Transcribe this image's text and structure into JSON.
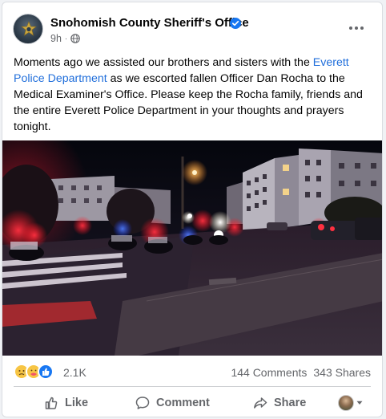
{
  "post": {
    "page_name": "Snohomish County Sheriff's Office",
    "time": "9h",
    "separator": "·",
    "text_before": "Moments ago we assisted our brothers and sisters with the ",
    "link_text": "Everett Police Department",
    "text_after": " as we escorted fallen Officer Dan Rocha to the Medical Examiner's Office. Please keep the Rocha family, friends and the entire Everett Police Department in your thoughts and prayers tonight."
  },
  "photo": {
    "description_icon": "night-police-escort-photo"
  },
  "reactions": {
    "icons": [
      "sad-reaction-icon",
      "care-reaction-icon",
      "like-reaction-icon"
    ],
    "count": "2.1K",
    "comments": "144 Comments",
    "shares": "343 Shares"
  },
  "actions": {
    "like": "Like",
    "comment": "Comment",
    "share": "Share"
  },
  "colors": {
    "link": "#216fdb",
    "secondary_text": "#65676b",
    "verified": "#1877f2",
    "like_blue": "#1877f2"
  }
}
